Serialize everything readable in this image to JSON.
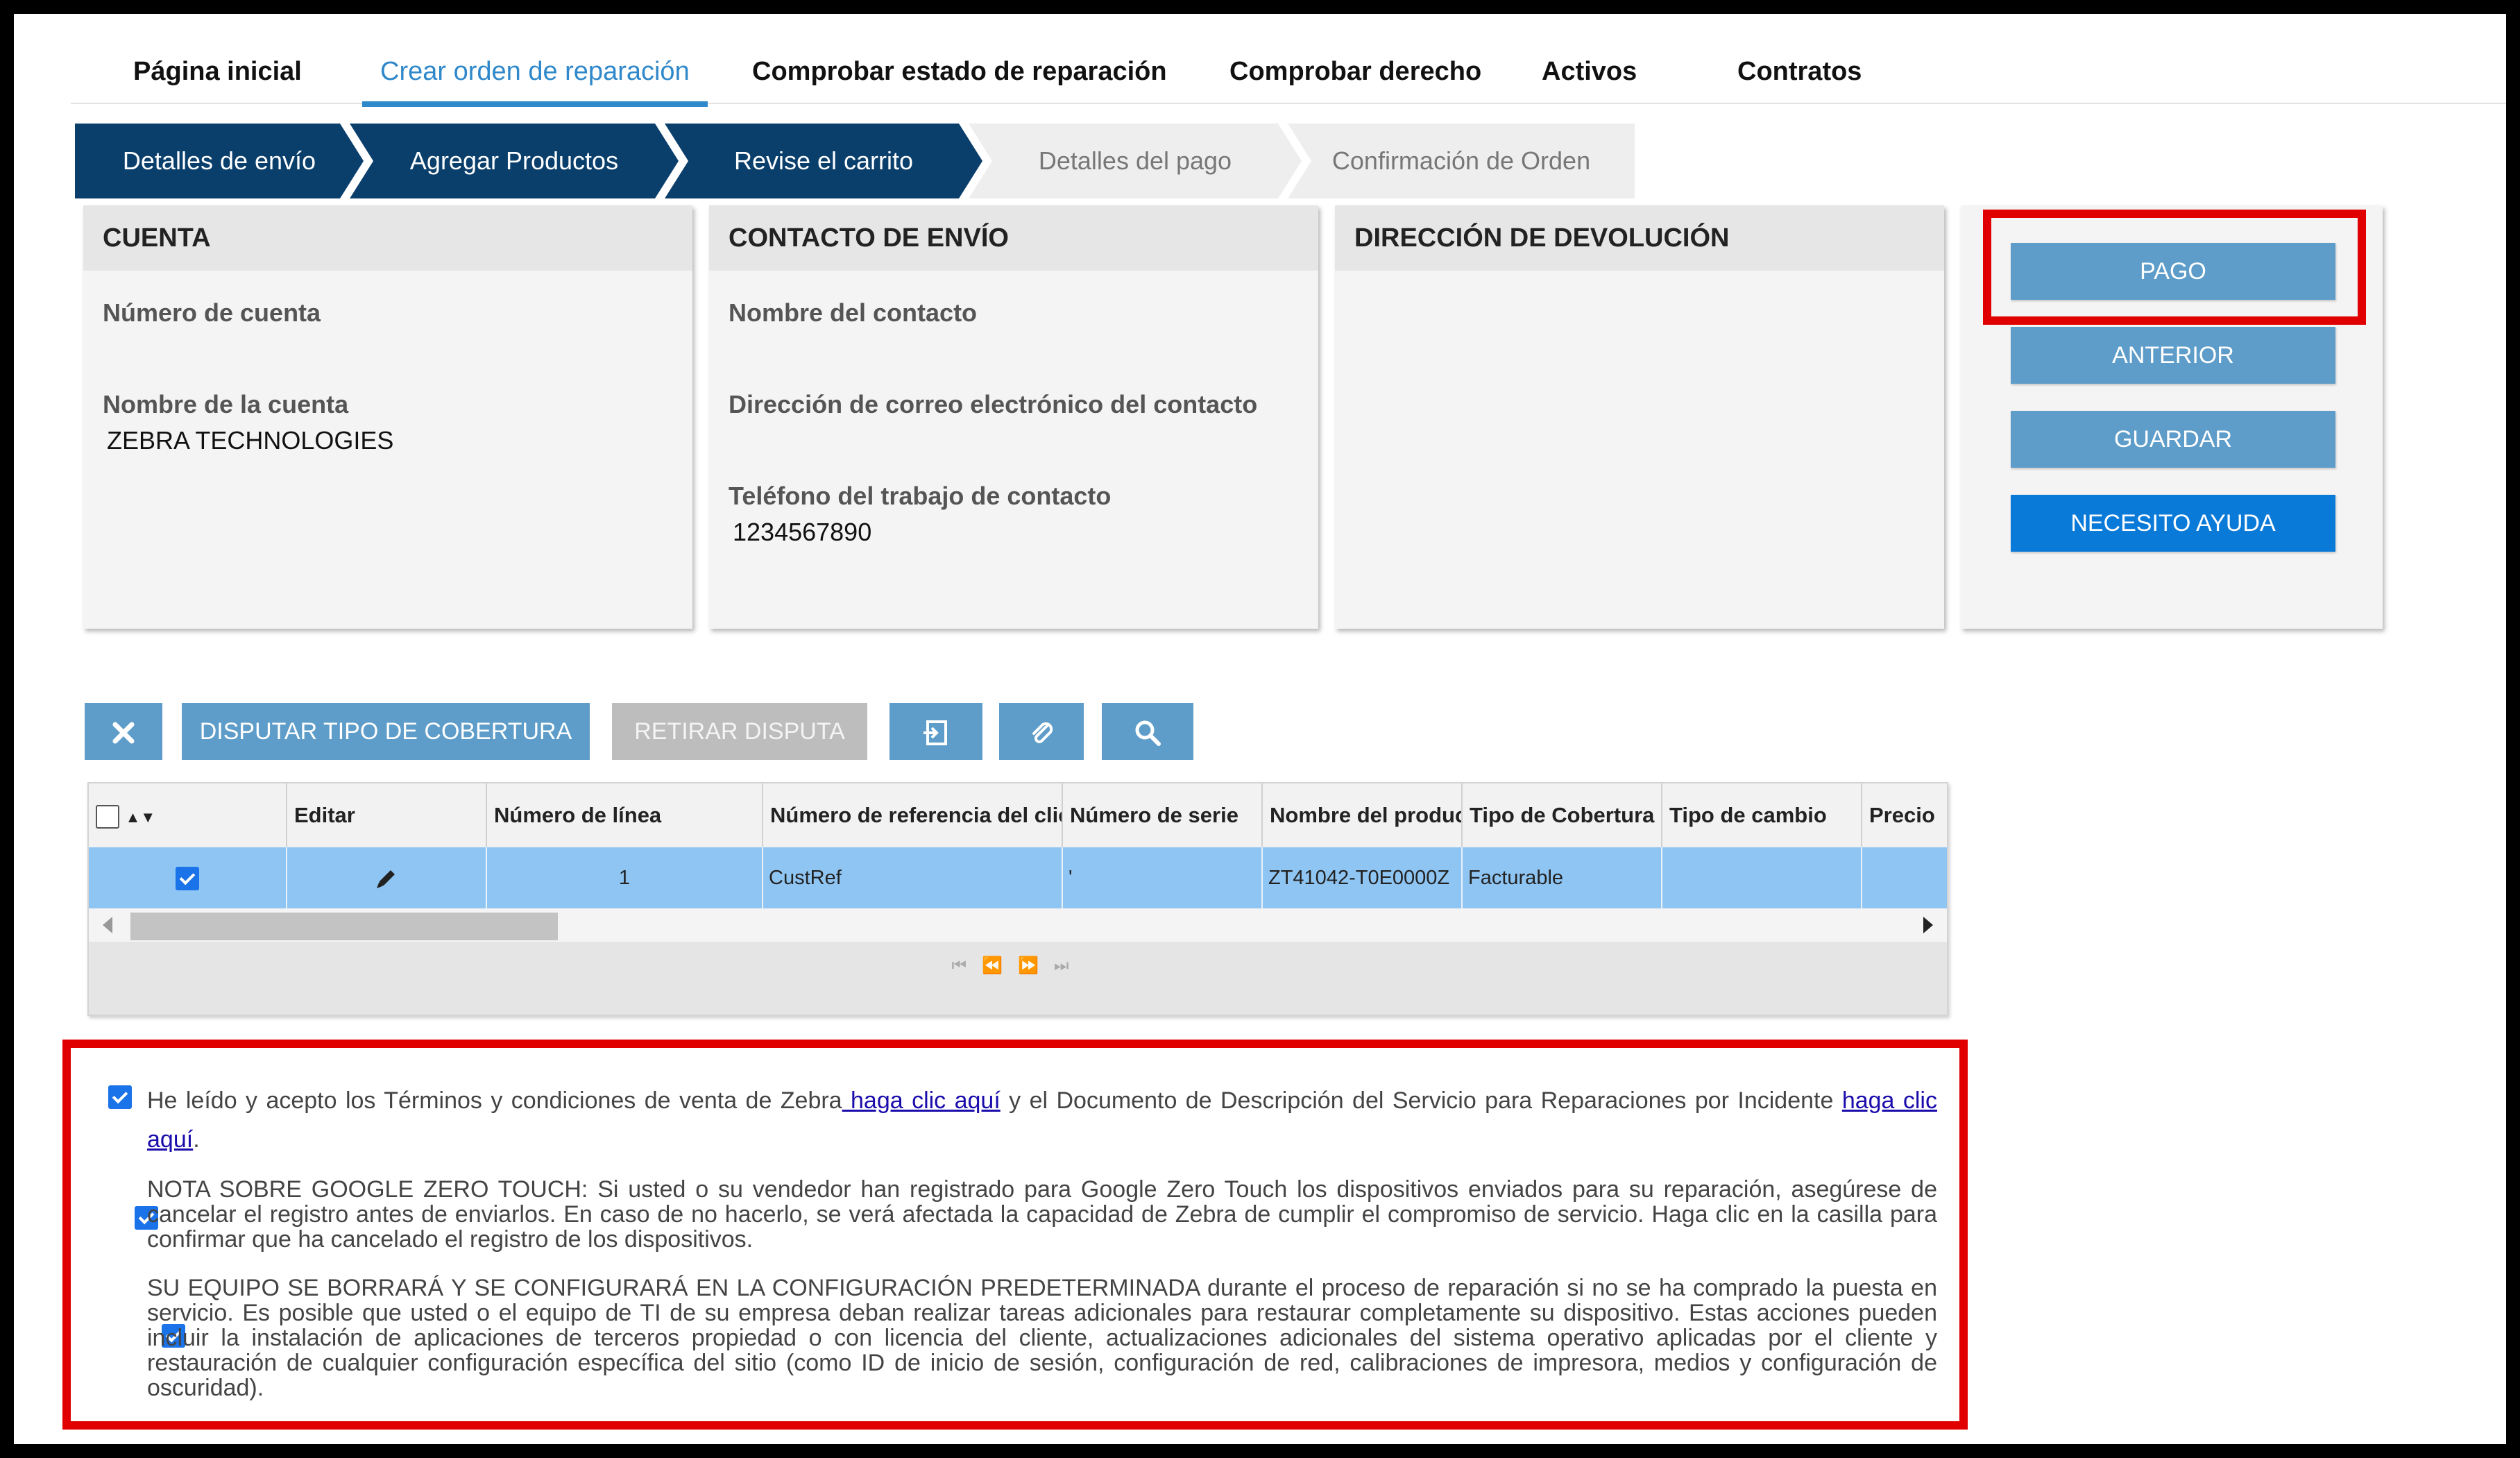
{
  "nav": {
    "items": [
      "Página inicial",
      "Crear orden de reparación",
      "Comprobar estado de reparación",
      "Comprobar derecho",
      "Activos",
      "Contratos"
    ],
    "active_index": 1
  },
  "steps": [
    {
      "label": "Detalles de envío",
      "done": true
    },
    {
      "label": "Agregar Productos",
      "done": true
    },
    {
      "label": "Revise el carrito",
      "done": true
    },
    {
      "label": "Detalles del pago",
      "done": false
    },
    {
      "label": "Confirmación de Orden",
      "done": false
    }
  ],
  "account": {
    "title": "CUENTA",
    "number_label": "Número de cuenta",
    "number_value": "",
    "name_label": "Nombre de la cuenta",
    "name_value": "ZEBRA TECHNOLOGIES"
  },
  "contact": {
    "title": "CONTACTO DE ENVÍO",
    "name_label": "Nombre del contacto",
    "email_label": "Dirección de correo electrónico del contacto",
    "phone_label": "Teléfono del trabajo de contacto",
    "phone_value": "1234567890"
  },
  "return_address": {
    "title": "DIRECCIÓN DE DEVOLUCIÓN"
  },
  "side_buttons": {
    "pay": "PAGO",
    "previous": "ANTERIOR",
    "save": "GUARDAR",
    "help": "NECESITO AYUDA"
  },
  "toolbar": {
    "dispute_coverage": "DISPUTAR TIPO DE COBERTURA",
    "withdraw_dispute": "RETIRAR DISPUTA",
    "icons": [
      "close-icon",
      "export-icon",
      "attachment-icon",
      "search-icon"
    ]
  },
  "grid": {
    "columns": [
      "",
      "Editar",
      "Número de línea",
      "Número de referencia del clie",
      "Número de serie",
      "Nombre del produc",
      "Tipo de Cobertura",
      "Tipo de cambio",
      "Precio"
    ],
    "rows": [
      {
        "checked": true,
        "line": "1",
        "ref": "CustRef",
        "serial": "'",
        "product": "ZT41042-T0E0000Z",
        "coverage": "Facturable",
        "exchange": "",
        "price": ""
      }
    ]
  },
  "terms": {
    "t1_text": "He leído y acepto los Términos y condiciones de venta de Zebra",
    "t1_link1": " haga clic aquí",
    "t1_mid": " y el Documento de Descripción del Servicio para Reparaciones por Incidente",
    "t1_link2": "haga clic aquí",
    "t1_end": ".",
    "t2_text": "NOTA SOBRE GOOGLE ZERO TOUCH: Si usted o su vendedor han registrado para Google Zero Touch los dispositivos enviados para su reparación, asegúrese de cancelar el registro antes de enviarlos.  En caso de no hacerlo, se verá afectada la capacidad de Zebra de cumplir el compromiso de servicio.   Haga clic en la casilla para confirmar que ha cancelado el registro de los dispositivos.",
    "t3_text": "SU EQUIPO SE BORRARÁ Y SE CONFIGURARÁ EN LA CONFIGURACIÓN PREDETERMINADA durante el proceso de reparación si no se ha comprado la puesta en servicio. Es posible que usted o el equipo de TI de su empresa deban realizar tareas adicionales para restaurar completamente su dispositivo. Estas acciones pueden incluir la instalación de aplicaciones de terceros propiedad o con licencia del cliente, actualizaciones adicionales del sistema operativo aplicadas por el cliente y restauración de cualquier configuración específica del sitio (como ID de inicio de sesión, configuración de red, calibraciones de impresora, medios y configuración de oscuridad)."
  },
  "colors": {
    "nav_active": "#2f88c9",
    "step_done": "#0a3f6c",
    "button": "#5e9dc9",
    "help_button": "#0a7ad9",
    "highlight_border": "#e00000",
    "selected_row": "#8fc5f3"
  }
}
